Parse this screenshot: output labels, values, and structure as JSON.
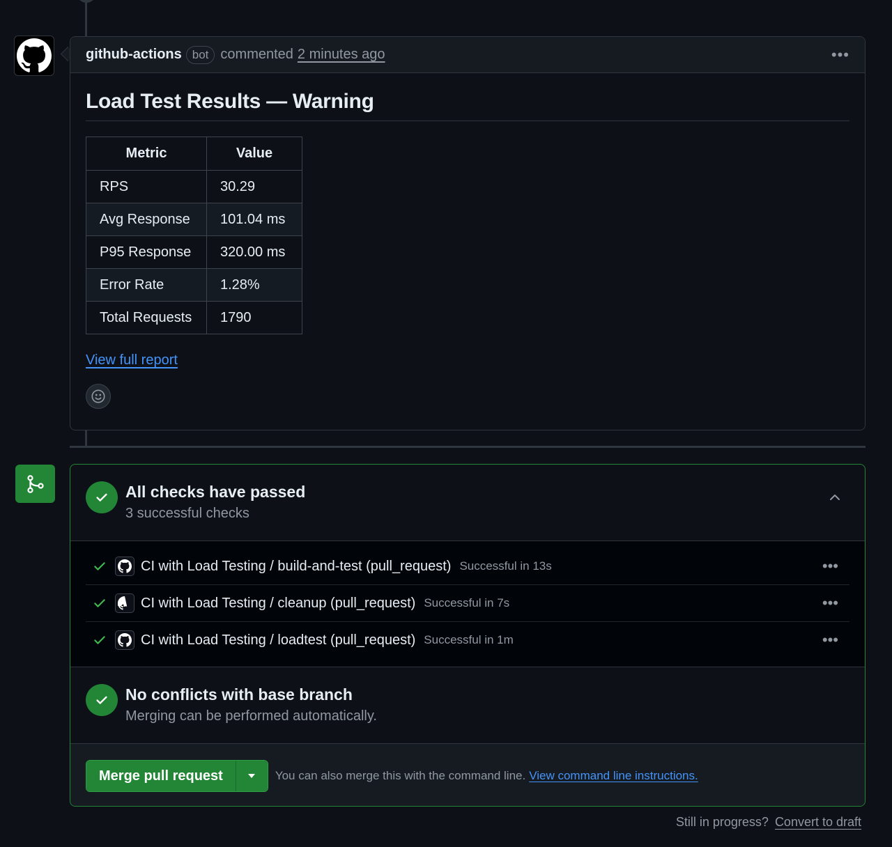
{
  "comment": {
    "author": "github-actions",
    "badge": "bot",
    "action": "commented",
    "time": "2 minutes ago",
    "title": "Load Test Results — Warning",
    "table": {
      "headers": [
        "Metric",
        "Value"
      ],
      "rows": [
        [
          "RPS",
          "30.29"
        ],
        [
          "Avg Response",
          "101.04 ms"
        ],
        [
          "P95 Response",
          "320.00 ms"
        ],
        [
          "Error Rate",
          "1.28%"
        ],
        [
          "Total Requests",
          "1790"
        ]
      ]
    },
    "report_link": "View full report"
  },
  "checks_section": {
    "title": "All checks have passed",
    "subtitle": "3 successful checks",
    "items": [
      {
        "name": "CI with Load Testing / build-and-test (pull_request)",
        "status": "Successful in 13s"
      },
      {
        "name": "CI with Load Testing / cleanup (pull_request)",
        "status": "Successful in 7s"
      },
      {
        "name": "CI with Load Testing / loadtest (pull_request)",
        "status": "Successful in 1m"
      }
    ]
  },
  "conflicts_section": {
    "title": "No conflicts with base branch",
    "subtitle": "Merging can be performed automatically."
  },
  "merge": {
    "button_label": "Merge pull request",
    "hint": "You can also merge this with the command line.",
    "cmd_link": "View command line instructions."
  },
  "footer": {
    "prompt": "Still in progress?",
    "draft_link": "Convert to draft"
  },
  "colors": {
    "success": "#238636",
    "link": "#4493f8",
    "background": "#0d1117"
  }
}
